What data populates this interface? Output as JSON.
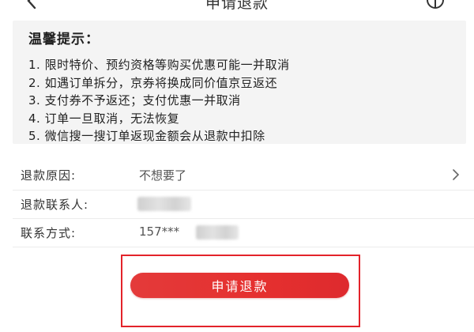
{
  "header": {
    "title": "申请退款",
    "back_icon": "back-arrow-icon",
    "service_icon": "customer-service-icon"
  },
  "notice": {
    "title": "温馨提示：",
    "items": [
      "1. 限时特价、预约资格等购买优惠可能一并取消",
      "2. 如遇订单拆分，京券将换成同价值京豆返还",
      "3. 支付券不予返还；支付优惠一并取消",
      "4. 订单一旦取消，无法恢复",
      "5. 微信搜一搜订单返现金额会从退款中扣除"
    ]
  },
  "form": {
    "reason": {
      "label": "退款原因:",
      "value": "不想要了",
      "chevron": ">"
    },
    "contact": {
      "label": "退款联系人:"
    },
    "phone": {
      "label": "联系方式:",
      "value": "157***"
    }
  },
  "submit": {
    "label": "申请退款"
  },
  "colors": {
    "accent": "#e5302f",
    "highlight_border": "#e3232a",
    "notice_bg": "#f4f4f4"
  }
}
